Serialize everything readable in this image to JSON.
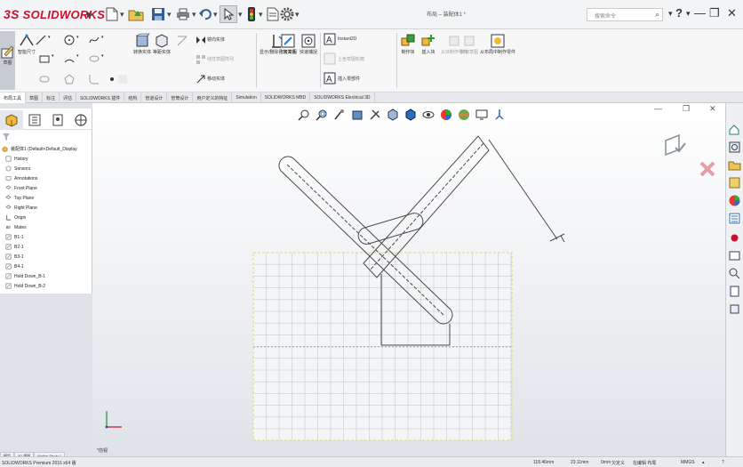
{
  "titlebar": {
    "logo_prefix": "3S",
    "logo_text": "SOLIDWORKS",
    "document_title": "布局 – 装配体1 *",
    "search_placeholder": "搜索命令",
    "help": "?",
    "minimize": "—",
    "restore": "❐",
    "close": "✕"
  },
  "commands": {
    "edit_sketch": "草图",
    "smart_dimension": "智能尺寸",
    "convert_entities": "转换实体",
    "offset_entities": "等距实体",
    "mirror_entities": "镜向实体",
    "linear_pattern": "线性草图阵列",
    "move_entities": "移动实体",
    "display_relations": "显示/删除几何关系",
    "repair_sketch": "修复草图",
    "quick_snaps": "快速捕捉",
    "instant2d": "Instant2D",
    "shaded_contours": "上色草图轮廓",
    "insert_component": "插入零部件",
    "make_block": "制作块",
    "insert_block": "插入块",
    "blocks_to_assembly": "从块制作零件",
    "rapid_sketch": "快速草图",
    "create_part": "从布局中制作零件"
  },
  "tabs": [
    {
      "label": "布局工具",
      "active": true
    },
    {
      "label": "草图",
      "active": false
    },
    {
      "label": "标注",
      "active": false
    },
    {
      "label": "评估",
      "active": false
    },
    {
      "label": "SOLIDWORKS 插件",
      "active": false
    },
    {
      "label": "结构",
      "active": false
    },
    {
      "label": "管道设计",
      "active": false
    },
    {
      "label": "管筒设计",
      "active": false
    },
    {
      "label": "用户定义的特征",
      "active": false
    },
    {
      "label": "Simulation",
      "active": false
    },
    {
      "label": "SOLIDWORKS MBD",
      "active": false
    },
    {
      "label": "SOLIDWORKS Electrical 3D",
      "active": false
    }
  ],
  "tree": {
    "root": "装配体1 (Default<Default_Display",
    "items": [
      {
        "label": "History",
        "icon": "history-icon"
      },
      {
        "label": "Sensors",
        "icon": "sensor-icon"
      },
      {
        "label": "Annotations",
        "icon": "annotation-icon"
      },
      {
        "label": "Front Plane",
        "icon": "plane-icon"
      },
      {
        "label": "Top Plane",
        "icon": "plane-icon"
      },
      {
        "label": "Right Plane",
        "icon": "plane-icon"
      },
      {
        "label": "Origin",
        "icon": "origin-icon"
      },
      {
        "label": "Mates",
        "icon": "mates-icon"
      },
      {
        "label": "B1-1",
        "icon": "block-icon"
      },
      {
        "label": "B2-1",
        "icon": "block-icon"
      },
      {
        "label": "B3-1",
        "icon": "block-icon"
      },
      {
        "label": "B4-1",
        "icon": "block-icon"
      },
      {
        "label": "Hold Down_B-1",
        "icon": "block-icon"
      },
      {
        "label": "Hold Down_B-2",
        "icon": "block-icon"
      }
    ]
  },
  "triad_label": "*前视",
  "bottom_tabs": [
    "模型",
    "3D 视图",
    "Motion Study 1"
  ],
  "status": {
    "product": "SOLIDWORKS Premium 2016 x64 版",
    "x_coord": "118.46mm",
    "y_coord": "23.11mm",
    "z_coord": "0mm",
    "sketch_state": "欠定义",
    "editing": "在编辑 布局",
    "units": "MMGS"
  },
  "colors": {
    "brand_red": "#c8102e",
    "sketch_line": "#4a4a4a",
    "grid_yellow": "#e0e08a",
    "grid_lines": "#c8ccd2"
  }
}
